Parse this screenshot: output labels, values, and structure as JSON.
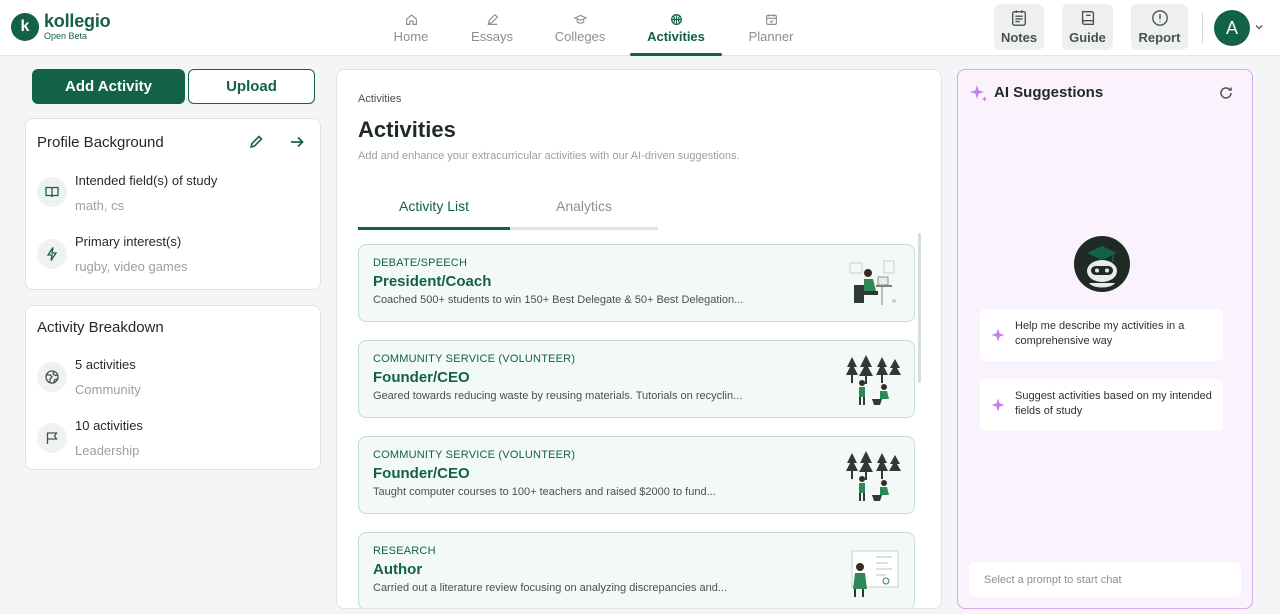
{
  "brand": {
    "name": "kollegio",
    "tag": "Open Beta",
    "mark": "k"
  },
  "nav": [
    {
      "label": "Home",
      "icon": "home-icon"
    },
    {
      "label": "Essays",
      "icon": "pen-icon"
    },
    {
      "label": "Colleges",
      "icon": "graduation-cap-icon"
    },
    {
      "label": "Activities",
      "icon": "basketball-icon",
      "active": true
    },
    {
      "label": "Planner",
      "icon": "calendar-icon"
    }
  ],
  "tools": [
    {
      "label": "Notes",
      "icon": "notes-icon"
    },
    {
      "label": "Guide",
      "icon": "book-icon"
    },
    {
      "label": "Report",
      "icon": "alert-circle-icon"
    }
  ],
  "user": {
    "initial": "A"
  },
  "actions": {
    "add": "Add Activity",
    "upload": "Upload"
  },
  "profile": {
    "title": "Profile Background",
    "items": [
      {
        "label": "Intended field(s) of study",
        "value": "math, cs",
        "icon": "book-open-icon"
      },
      {
        "label": "Primary interest(s)",
        "value": "rugby, video games",
        "icon": "lightning-icon"
      }
    ]
  },
  "breakdown": {
    "title": "Activity Breakdown",
    "items": [
      {
        "label": "5 activities",
        "value": "Community",
        "icon": "globe-icon"
      },
      {
        "label": "10 activities",
        "value": "Leadership",
        "icon": "flag-icon"
      }
    ]
  },
  "main": {
    "breadcrumb": "Activities",
    "title": "Activities",
    "subtitle": "Add and enhance your extracurricular activities with our AI-driven suggestions.",
    "tabs": [
      "Activity List",
      "Analytics"
    ],
    "activities": [
      {
        "category": "DEBATE/SPEECH",
        "role": "President/Coach",
        "description": "Coached 500+ students to win 150+ Best Delegate & 50+ Best Delegation..."
      },
      {
        "category": "COMMUNITY SERVICE (VOLUNTEER)",
        "role": "Founder/CEO",
        "description": "Geared towards reducing waste by reusing materials. Tutorials on recyclin..."
      },
      {
        "category": "COMMUNITY SERVICE (VOLUNTEER)",
        "role": "Founder/CEO",
        "description": "Taught computer courses to 100+ teachers and raised $2000 to fund..."
      },
      {
        "category": "RESEARCH",
        "role": "Author",
        "description": "Carried out a literature review focusing on analyzing discrepancies and..."
      }
    ]
  },
  "ai": {
    "title": "AI Suggestions",
    "prompts": [
      "Help me describe my activities in a comprehensive way",
      "Suggest activities based on my intended fields of study"
    ],
    "input_placeholder": "Select a prompt to start chat"
  },
  "colors": {
    "brand": "#14614a",
    "ai_border": "#d8a9ec",
    "ai_bg": "#faf2fd",
    "card_bg": "#f3f9f7"
  }
}
